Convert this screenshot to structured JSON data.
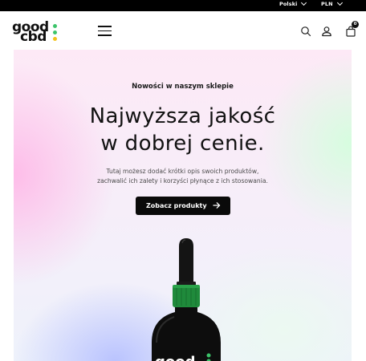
{
  "topbar": {
    "language": "Polski",
    "currency": "PLN"
  },
  "header": {
    "logo_line1": "good",
    "logo_line2": "cbd",
    "cart_count": "0"
  },
  "hero": {
    "eyebrow": "Nowości w naszym sklepie",
    "headline_line1": "Najwyższa jakość",
    "headline_line2": "w dobrej cenie.",
    "description_line1": "Tutaj możesz dodać krótki opis swoich produktów,",
    "description_line2": "zachwalić ich zalety i korzyści płynące z ich stosowania.",
    "cta_label": "Zobacz produkty",
    "bottle_label": "good"
  },
  "colors": {
    "logo_dot_1": "#3cc46a",
    "logo_dot_2": "#3cc46a",
    "logo_dot_3": "#f2c21b",
    "cap_green": "#1f8a3b"
  }
}
